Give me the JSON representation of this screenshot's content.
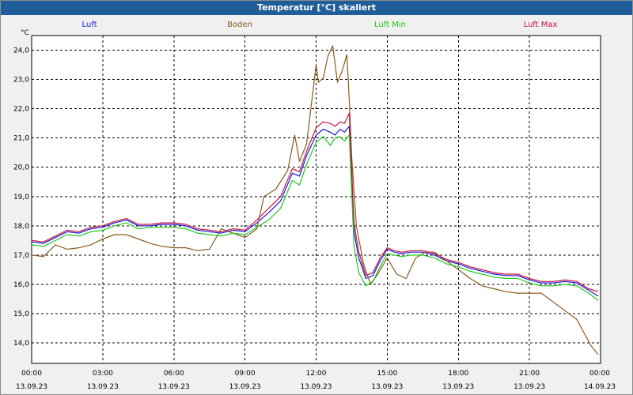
{
  "window": {
    "title": "Temperatur [°C] skaliert"
  },
  "colors": {
    "Luft": "#1a1adc",
    "Boden": "#8b5a1f",
    "Luft Min": "#1ec81e",
    "Luft Max": "#c8143c",
    "grid": "#000000",
    "plot_bg": "#ffffff"
  },
  "chart_data": {
    "type": "line",
    "title": "Temperatur [°C] skaliert",
    "ylabel": "°C",
    "xlabel": "",
    "ylim": [
      13.3,
      24.5
    ],
    "xlim": [
      0,
      24
    ],
    "grid": true,
    "legend_placement": "top",
    "y_ticks": [
      "24,0",
      "23,0",
      "22,0",
      "21,0",
      "20,0",
      "19,0",
      "18,0",
      "17,0",
      "16,0",
      "15,0",
      "14,0"
    ],
    "y_tick_values": [
      24,
      23,
      22,
      21,
      20,
      19,
      18,
      17,
      16,
      15,
      14
    ],
    "x_ticks": [
      {
        "time": "00:00",
        "date": "13.09.23"
      },
      {
        "time": "03:00",
        "date": "13.09.23"
      },
      {
        "time": "06:00",
        "date": "13.09.23"
      },
      {
        "time": "09:00",
        "date": "13.09.23"
      },
      {
        "time": "12:00",
        "date": "13.09.23"
      },
      {
        "time": "15:00",
        "date": "13.09.23"
      },
      {
        "time": "18:00",
        "date": "13.09.23"
      },
      {
        "time": "21:00",
        "date": "13.09.23"
      },
      {
        "time": "00:00",
        "date": "14.09.23"
      }
    ],
    "x_tick_values": [
      0,
      3,
      6,
      9,
      12,
      15,
      18,
      21,
      24
    ],
    "series": [
      {
        "name": "Luft",
        "x": [
          0,
          0.5,
          1,
          1.5,
          2,
          2.5,
          3,
          3.5,
          4,
          4.5,
          5,
          5.5,
          6,
          6.5,
          7,
          7.5,
          8,
          8.5,
          9,
          9.5,
          10,
          10.5,
          11,
          11.3,
          11.6,
          12,
          12.3,
          12.6,
          12.8,
          13,
          13.2,
          13.4,
          13.6,
          13.8,
          14.1,
          14.4,
          14.7,
          15,
          15.3,
          15.6,
          16,
          16.5,
          17,
          17.5,
          18,
          18.5,
          19,
          19.5,
          20,
          20.5,
          21,
          21.5,
          22,
          22.5,
          23,
          23.5,
          23.9
        ],
        "y": [
          17.45,
          17.4,
          17.6,
          17.8,
          17.75,
          17.9,
          17.95,
          18.1,
          18.2,
          18.0,
          18.0,
          18.05,
          18.05,
          18.0,
          17.85,
          17.8,
          17.75,
          17.85,
          17.8,
          18.1,
          18.45,
          18.85,
          19.8,
          19.7,
          20.4,
          21.1,
          21.3,
          21.2,
          21.1,
          21.3,
          21.2,
          21.4,
          17.8,
          16.9,
          16.2,
          16.3,
          16.8,
          17.2,
          17.1,
          17.05,
          17.1,
          17.1,
          17.0,
          16.8,
          16.7,
          16.55,
          16.45,
          16.35,
          16.3,
          16.3,
          16.15,
          16.05,
          16.05,
          16.1,
          16.05,
          15.8,
          15.6
        ]
      },
      {
        "name": "Boden",
        "x": [
          0,
          0.5,
          1,
          1.5,
          2,
          2.5,
          3,
          3.5,
          4,
          4.5,
          5,
          5.5,
          6,
          6.5,
          7,
          7.5,
          8,
          8.5,
          9,
          9.5,
          9.8,
          10.3,
          10.8,
          11.1,
          11.3,
          11.6,
          12.0,
          12.1,
          12.3,
          12.5,
          12.7,
          12.9,
          13.1,
          13.3,
          13.4,
          13.5,
          13.7,
          14.0,
          14.3,
          14.6,
          15.0,
          15.4,
          15.8,
          16.2,
          16.6,
          17.0,
          17.5,
          18,
          18.5,
          19,
          19.5,
          20,
          20.5,
          21,
          21.5,
          22,
          22.5,
          23,
          23.3,
          23.6,
          23.9
        ],
        "y": [
          17.0,
          16.95,
          17.35,
          17.2,
          17.25,
          17.35,
          17.55,
          17.7,
          17.7,
          17.55,
          17.4,
          17.3,
          17.25,
          17.25,
          17.15,
          17.2,
          17.9,
          17.75,
          17.6,
          17.9,
          19.0,
          19.25,
          19.9,
          21.1,
          20.2,
          20.8,
          23.5,
          22.9,
          23.05,
          23.8,
          24.15,
          22.9,
          23.3,
          23.85,
          22.3,
          20.4,
          18.0,
          16.7,
          16.0,
          16.35,
          16.9,
          16.35,
          16.2,
          16.9,
          17.1,
          17.1,
          16.8,
          16.5,
          16.2,
          15.95,
          15.85,
          15.75,
          15.7,
          15.7,
          15.7,
          15.4,
          15.1,
          14.8,
          14.35,
          13.9,
          13.6
        ]
      },
      {
        "name": "Luft Min",
        "x": [
          0,
          0.5,
          1,
          1.5,
          2,
          2.5,
          3,
          3.5,
          4,
          4.5,
          5,
          5.5,
          6,
          6.5,
          7,
          7.5,
          8,
          8.5,
          9,
          9.5,
          10,
          10.5,
          11,
          11.3,
          11.6,
          12,
          12.3,
          12.6,
          12.8,
          13,
          13.2,
          13.4,
          13.6,
          13.8,
          14.1,
          14.4,
          14.7,
          15,
          15.3,
          15.6,
          16,
          16.5,
          17,
          17.5,
          18,
          18.5,
          19,
          19.5,
          20,
          20.5,
          21,
          21.5,
          22,
          22.5,
          23,
          23.5,
          23.9
        ],
        "y": [
          17.35,
          17.3,
          17.5,
          17.7,
          17.65,
          17.8,
          17.85,
          18.0,
          18.1,
          17.9,
          17.95,
          17.95,
          17.95,
          17.9,
          17.75,
          17.7,
          17.65,
          17.75,
          17.7,
          17.95,
          18.2,
          18.6,
          19.55,
          19.4,
          20.1,
          20.85,
          21.05,
          20.75,
          21.0,
          21.05,
          20.9,
          21.1,
          17.3,
          16.4,
          15.95,
          16.1,
          16.6,
          17.05,
          17.0,
          16.95,
          17.0,
          17.0,
          16.9,
          16.7,
          16.6,
          16.45,
          16.35,
          16.25,
          16.2,
          16.2,
          16.05,
          15.95,
          15.95,
          16.0,
          15.95,
          15.7,
          15.45
        ]
      },
      {
        "name": "Luft Max",
        "x": [
          0,
          0.5,
          1,
          1.5,
          2,
          2.5,
          3,
          3.5,
          4,
          4.5,
          5,
          5.5,
          6,
          6.5,
          7,
          7.5,
          8,
          8.5,
          9,
          9.5,
          10,
          10.5,
          11,
          11.3,
          11.6,
          12,
          12.3,
          12.6,
          12.8,
          13,
          13.2,
          13.4,
          13.6,
          13.8,
          14.1,
          14.4,
          14.7,
          15,
          15.3,
          15.6,
          16,
          16.5,
          17,
          17.5,
          18,
          18.5,
          19,
          19.5,
          20,
          20.5,
          21,
          21.5,
          22,
          22.5,
          23,
          23.5,
          23.9
        ],
        "y": [
          17.5,
          17.45,
          17.65,
          17.85,
          17.8,
          17.95,
          18.0,
          18.15,
          18.25,
          18.05,
          18.05,
          18.1,
          18.1,
          18.05,
          17.9,
          17.85,
          17.8,
          17.9,
          17.85,
          18.2,
          18.6,
          19.0,
          19.95,
          19.85,
          20.55,
          21.35,
          21.55,
          21.5,
          21.4,
          21.55,
          21.5,
          21.85,
          18.1,
          17.1,
          16.3,
          16.4,
          16.9,
          17.25,
          17.15,
          17.1,
          17.15,
          17.15,
          17.05,
          16.85,
          16.75,
          16.6,
          16.5,
          16.4,
          16.35,
          16.35,
          16.2,
          16.1,
          16.1,
          16.15,
          16.1,
          15.85,
          15.75
        ]
      }
    ]
  }
}
